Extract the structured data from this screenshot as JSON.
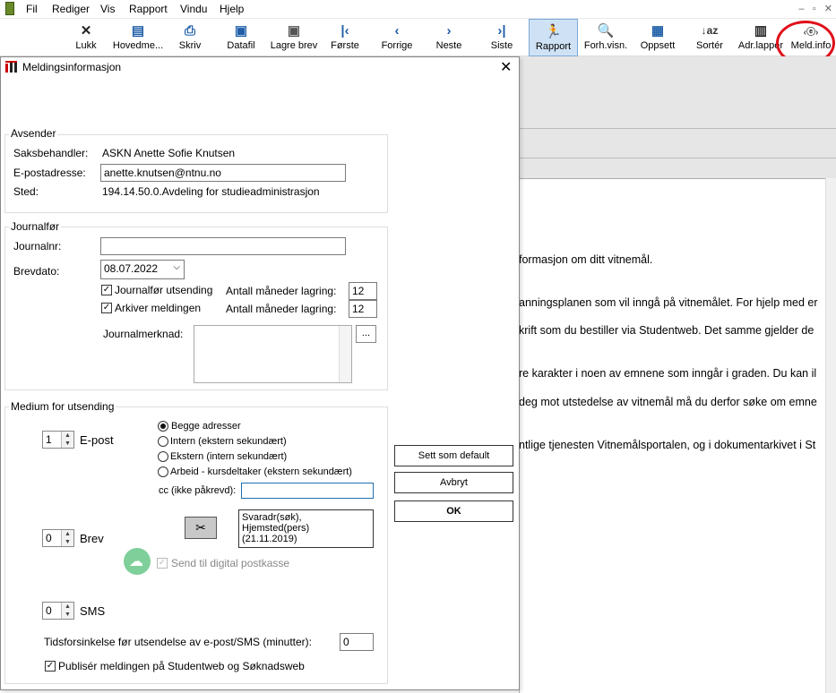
{
  "menu": {
    "items": [
      "Fil",
      "Rediger",
      "Vis",
      "Rapport",
      "Vindu",
      "Hjelp"
    ]
  },
  "toolbar": {
    "buttons": [
      {
        "label": "Lukk",
        "icon": "close-icon"
      },
      {
        "label": "Hovedme...",
        "icon": "main-menu-icon"
      },
      {
        "label": "Skriv",
        "icon": "printer-icon"
      },
      {
        "label": "Datafil",
        "icon": "save-icon"
      },
      {
        "label": "Lagre brev",
        "icon": "save-letter-icon"
      },
      {
        "label": "Første",
        "icon": "first-icon"
      },
      {
        "label": "Forrige",
        "icon": "previous-icon"
      },
      {
        "label": "Neste",
        "icon": "next-icon"
      },
      {
        "label": "Siste",
        "icon": "last-icon"
      },
      {
        "label": "Rapport",
        "icon": "report-icon"
      },
      {
        "label": "Forh.visn.",
        "icon": "preview-icon"
      },
      {
        "label": "Oppsett",
        "icon": "setup-icon"
      },
      {
        "label": "Sortér",
        "icon": "sort-icon"
      },
      {
        "label": "Adr.lapper",
        "icon": "address-labels-icon"
      },
      {
        "label": "Meld.info",
        "icon": "message-info-icon"
      }
    ]
  },
  "background": {
    "lines": [
      "formasjon om ditt vitnemål.",
      "anningsplanen som vil inngå på vitnemålet. For hjelp med er",
      "krift som du bestiller via Studentweb. Det samme gjelder de",
      "re karakter i noen av emnene som inngår i graden. Du kan il",
      "deg mot utstedelse av vitnemål må du derfor søke om emne",
      "ntlige tjenesten Vitnemålsportalen, og i dokumentarkivet i St"
    ]
  },
  "dialog": {
    "title": "Meldingsinformasjon",
    "sender": {
      "legend": "Avsender",
      "handler_label": "Saksbehandler:",
      "handler_value": "ASKN Anette Sofie Knutsen",
      "email_label": "E-postadresse:",
      "email_value": "anette.knutsen@ntnu.no",
      "place_label": "Sted:",
      "place_value": "194.14.50.0.Avdeling for studieadministrasjon"
    },
    "journal": {
      "legend": "Journalfør",
      "journalnr_label": "Journalnr:",
      "journalnr_value": "",
      "date_label": "Brevdato:",
      "date_value": "08.07.2022",
      "journal_send_label": "Journalfør utsending",
      "archive_label": "Arkiver meldingen",
      "months_label": "Antall måneder lagring:",
      "months1": "12",
      "months2": "12",
      "remark_label": "Journalmerknad:",
      "remark_button": "..."
    },
    "medium": {
      "legend": "Medium for utsending",
      "email_count": "1",
      "email_label": "E-post",
      "radios": [
        "Begge adresser",
        "Intern (ekstern sekundært)",
        "Ekstern (intern sekundært)",
        "Arbeid - kursdeltaker (ekstern sekundært)"
      ],
      "cc_label": "cc (ikke påkrevd):",
      "cc_value": "",
      "letter_count": "0",
      "letter_label": "Brev",
      "address_text": "Svaradr(søk), Hjemsted(pers)\n(21.11.2019)",
      "digital_label": "Send til digital postkasse",
      "sms_count": "0",
      "sms_label": "SMS",
      "delay_label": "Tidsforsinkelse før utsendelse av e-post/SMS (minutter):",
      "delay_value": "0",
      "publish_label": "Publisér meldingen på Studentweb og Søknadsweb"
    },
    "buttons": {
      "default": "Sett som default",
      "cancel": "Avbryt",
      "ok": "OK"
    }
  },
  "colors": {
    "accent": "#1f5fa8",
    "highlight": "#e0101a",
    "active_tab": "#cfe2f5"
  }
}
